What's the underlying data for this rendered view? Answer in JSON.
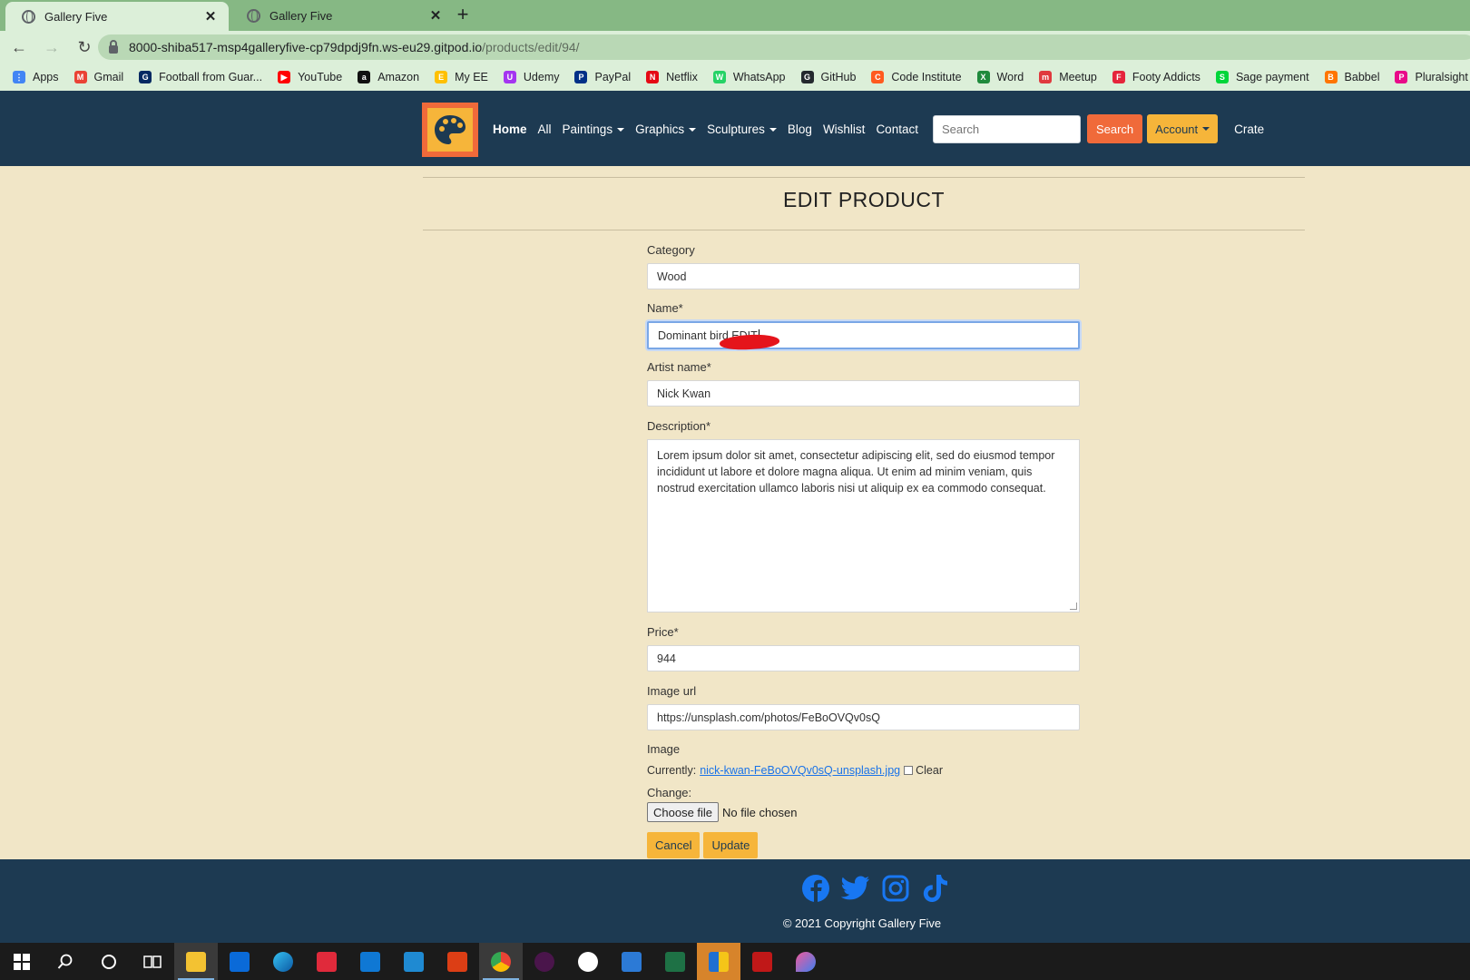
{
  "browser": {
    "tabs": [
      {
        "title": "Gallery Five",
        "active": true
      },
      {
        "title": "Gallery Five",
        "active": false
      }
    ],
    "new_tab": "+",
    "nav": {
      "back": "←",
      "forward": "→",
      "reload": "↻"
    },
    "url_host": "8000-shiba517-msp4galleryfive-cp79dpdj9fn.ws-eu29.gitpod.io",
    "url_path": "/products/edit/94/",
    "bookmarks": [
      {
        "label": "Apps",
        "color": "#4285f4",
        "glyph": "⋮"
      },
      {
        "label": "Gmail",
        "color": "#ea4335",
        "glyph": "M"
      },
      {
        "label": "Football from Guar...",
        "color": "#052962",
        "glyph": "G"
      },
      {
        "label": "YouTube",
        "color": "#ff0000",
        "glyph": "▶"
      },
      {
        "label": "Amazon",
        "color": "#111111",
        "glyph": "a"
      },
      {
        "label": "My EE",
        "color": "#ffc000",
        "glyph": "E"
      },
      {
        "label": "Udemy",
        "color": "#a435f0",
        "glyph": "U"
      },
      {
        "label": "PayPal",
        "color": "#003087",
        "glyph": "P"
      },
      {
        "label": "Netflix",
        "color": "#e50914",
        "glyph": "N"
      },
      {
        "label": "WhatsApp",
        "color": "#25d366",
        "glyph": "W"
      },
      {
        "label": "GitHub",
        "color": "#24292e",
        "glyph": "G"
      },
      {
        "label": "Code Institute",
        "color": "#ff5a1f",
        "glyph": "C"
      },
      {
        "label": "Word",
        "color": "#1f8a3c",
        "glyph": "X"
      },
      {
        "label": "Meetup",
        "color": "#e0393e",
        "glyph": "m"
      },
      {
        "label": "Footy Addicts",
        "color": "#e5243b",
        "glyph": "F"
      },
      {
        "label": "Sage payment",
        "color": "#00d639",
        "glyph": "S"
      },
      {
        "label": "Babbel",
        "color": "#ff7500",
        "glyph": "B"
      },
      {
        "label": "Pluralsight",
        "color": "#e80a89",
        "glyph": "P"
      }
    ]
  },
  "header": {
    "nav": [
      {
        "label": "Home",
        "bold": true,
        "dropdown": false
      },
      {
        "label": "All",
        "bold": false,
        "dropdown": false
      },
      {
        "label": "Paintings",
        "bold": false,
        "dropdown": true
      },
      {
        "label": "Graphics",
        "bold": false,
        "dropdown": true
      },
      {
        "label": "Sculptures",
        "bold": false,
        "dropdown": true
      },
      {
        "label": "Blog",
        "bold": false,
        "dropdown": false
      },
      {
        "label": "Wishlist",
        "bold": false,
        "dropdown": false
      },
      {
        "label": "Contact",
        "bold": false,
        "dropdown": false
      }
    ],
    "search_placeholder": "Search",
    "search_button": "Search",
    "account": "Account",
    "crate": "Crate"
  },
  "page": {
    "title": "EDIT PRODUCT",
    "form": {
      "category_label": "Category",
      "category_value": "Wood",
      "name_label": "Name*",
      "name_value": "Dominant bird EDIT",
      "artist_label": "Artist name*",
      "artist_value": "Nick Kwan",
      "description_label": "Description*",
      "description_value": "Lorem ipsum dolor sit amet, consectetur adipiscing elit, sed do eiusmod tempor incididunt ut labore et dolore magna aliqua. Ut enim ad minim veniam, quis nostrud exercitation ullamco laboris nisi ut aliquip ex ea commodo consequat.",
      "price_label": "Price*",
      "price_value": "944",
      "image_url_label": "Image url",
      "image_url_value": "https://unsplash.com/photos/FeBoOVQv0sQ",
      "image_label": "Image",
      "currently_label": "Currently:",
      "current_file": "nick-kwan-FeBoOVQv0sQ-unsplash.jpg",
      "clear_label": "Clear",
      "change_label": "Change:",
      "choose_file": "Choose file",
      "no_file": "No file chosen",
      "cancel": "Cancel",
      "update": "Update"
    }
  },
  "footer": {
    "social": [
      "facebook-icon",
      "twitter-icon",
      "instagram-icon",
      "tiktok-icon"
    ],
    "copyright": "© 2021 Copyright Gallery Five"
  },
  "colors": {
    "header_bg": "#1d3a52",
    "page_bg": "#f1e6c7",
    "accent_orange": "#f06a3a",
    "accent_yellow": "#f6b53a",
    "social_blue": "#1877f2"
  }
}
